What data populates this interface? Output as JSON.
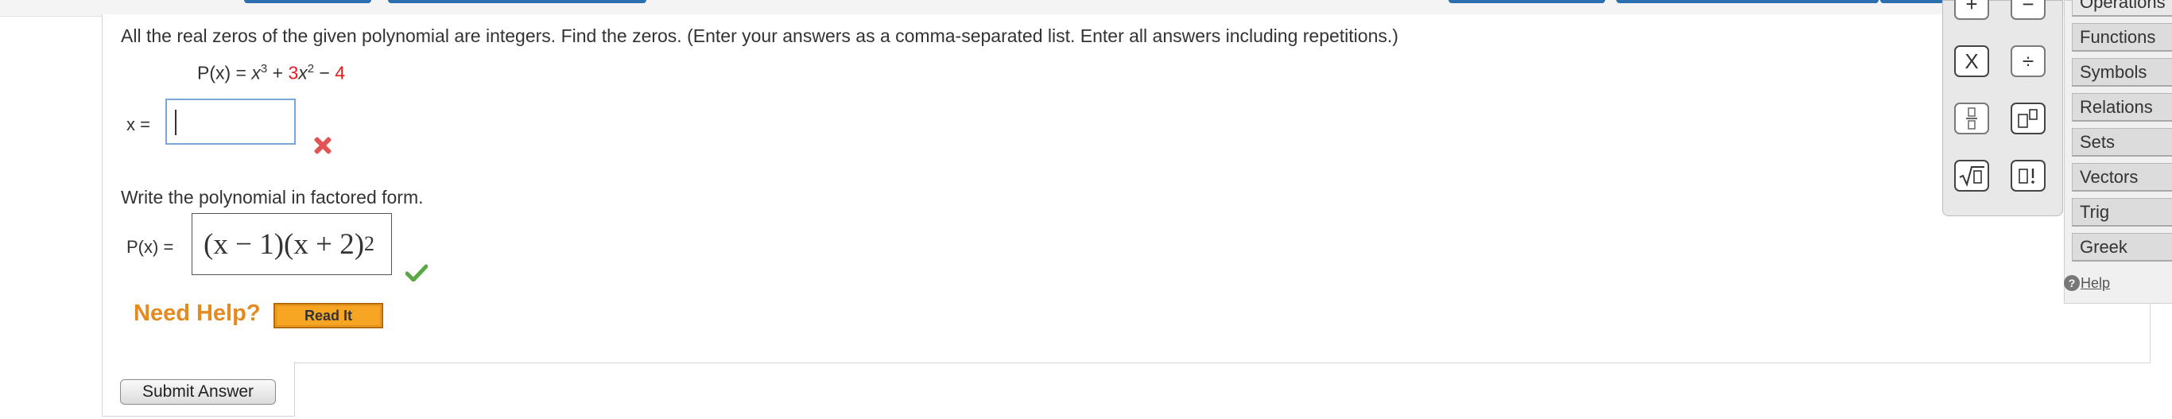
{
  "question": {
    "text": "All the real zeros of the given polynomial are integers. Find the zeros. (Enter your answers as a comma-separated list. Enter all answers including repetitions.)",
    "poly_label": "P(x) =",
    "poly_term1": "x",
    "poly_exp1": "3",
    "poly_plus": "+",
    "poly_coef2": "3",
    "poly_term2": "x",
    "poly_exp2": "2",
    "poly_minus": "−",
    "poly_const": "4"
  },
  "zeros": {
    "label": "x =",
    "value": ""
  },
  "factored": {
    "prompt": "Write the polynomial in factored form.",
    "label": "P(x) =",
    "answer_part1": "(x − 1)(x + 2)",
    "answer_exp": "2"
  },
  "help": {
    "need_help": "Need Help?",
    "read_it": "Read It"
  },
  "submit": {
    "label": "Submit Answer"
  },
  "palette": {
    "buttons": [
      "+",
      "−",
      "X",
      "÷",
      "fraction",
      "superscript",
      "sqrt",
      "factorial"
    ]
  },
  "tabs": [
    "Operations",
    "Functions",
    "Symbols",
    "Relations",
    "Sets",
    "Vectors",
    "Trig",
    "Greek"
  ],
  "help_link": "Help"
}
